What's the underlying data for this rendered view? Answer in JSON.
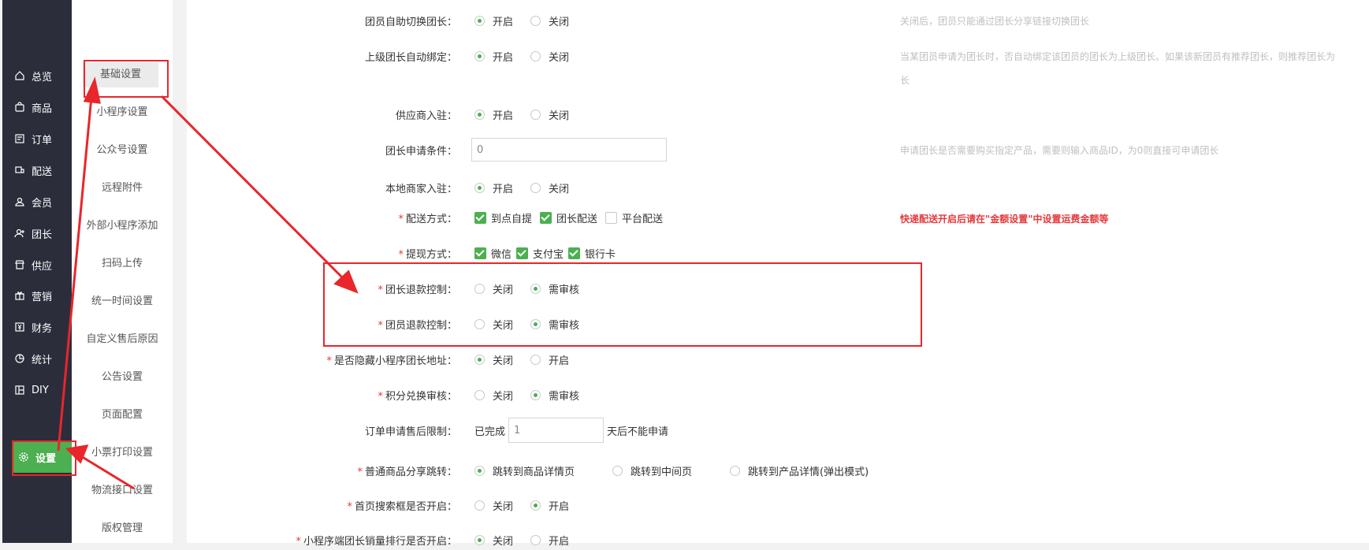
{
  "main_nav": [
    {
      "label": "总览",
      "icon": "home-icon"
    },
    {
      "label": "商品",
      "icon": "bag-icon"
    },
    {
      "label": "订单",
      "icon": "order-icon"
    },
    {
      "label": "配送",
      "icon": "delivery-icon"
    },
    {
      "label": "会员",
      "icon": "user-icon"
    },
    {
      "label": "团长",
      "icon": "leader-icon"
    },
    {
      "label": "供应",
      "icon": "store-icon"
    },
    {
      "label": "营销",
      "icon": "gift-icon"
    },
    {
      "label": "财务",
      "icon": "finance-icon"
    },
    {
      "label": "统计",
      "icon": "pie-chart-icon"
    },
    {
      "label": "DIY",
      "icon": "layout-icon"
    },
    {
      "label": "设置",
      "icon": "gear-icon",
      "active": true
    }
  ],
  "sub_nav": [
    {
      "label": "基础设置",
      "active": true
    },
    {
      "label": "小程序设置"
    },
    {
      "label": "公众号设置"
    },
    {
      "label": "远程附件"
    },
    {
      "label": "外部小程序添加"
    },
    {
      "label": "扫码上传"
    },
    {
      "label": "统一时间设置"
    },
    {
      "label": "自定义售后原因"
    },
    {
      "label": "公告设置"
    },
    {
      "label": "页面配置"
    },
    {
      "label": "小票打印设置"
    },
    {
      "label": "物流接口设置"
    },
    {
      "label": "版权管理"
    }
  ],
  "form": {
    "member_switch": {
      "label": "团员自助切换团长：",
      "opt1": "开启",
      "opt2": "关闭",
      "hint": "关闭后，团员只能通过团长分享链接切换团长"
    },
    "auto_bind": {
      "label": "上级团长自动绑定：",
      "opt1": "开启",
      "opt2": "关闭",
      "hint1": "当某团员申请为团长时，否自动绑定该团员的团长为上级团长。如果该新团员有推荐团长，则推荐团长为",
      "hint2": "长"
    },
    "supplier": {
      "label": "供应商入驻：",
      "opt1": "开启",
      "opt2": "关闭"
    },
    "apply_condition": {
      "label": "团长申请条件：",
      "value": "0",
      "hint": "申请团长是否需要购买指定产品，需要则输入商品ID，为0则直接可申请团长"
    },
    "local_merchant": {
      "label": "本地商家入驻：",
      "opt1": "开启",
      "opt2": "关闭"
    },
    "delivery": {
      "req": "*",
      "label": "配送方式：",
      "opt1": "到点自提",
      "opt2": "团长配送",
      "opt3": "平台配送",
      "hint": "快递配送开启后请在\"金额设置\"中设置运费金额等"
    },
    "withdraw": {
      "req": "*",
      "label": "提现方式：",
      "opt1": "微信",
      "opt2": "支付宝",
      "opt3": "银行卡"
    },
    "leader_refund": {
      "req": "*",
      "label": "团长退款控制：",
      "opt1": "关闭",
      "opt2": "需审核"
    },
    "member_refund": {
      "req": "*",
      "label": "团员退款控制：",
      "opt1": "关闭",
      "opt2": "需审核"
    },
    "hide_address": {
      "req": "*",
      "label": "是否隐藏小程序团长地址：",
      "opt1": "关闭",
      "opt2": "开启"
    },
    "points_review": {
      "req": "*",
      "label": "积分兑换审核：",
      "opt1": "关闭",
      "opt2": "需审核"
    },
    "after_sale": {
      "label": "订单申请售后限制：",
      "prefix": "已完成",
      "value": "1",
      "suffix": "天后不能申请"
    },
    "share_jump": {
      "req": "*",
      "label": "普通商品分享跳转：",
      "opt1": "跳转到商品详情页",
      "opt2": "跳转到中间页",
      "opt3": "跳转到产品详情(弹出模式)"
    },
    "search_box": {
      "req": "*",
      "label": "首页搜索框是否开启：",
      "opt1": "关闭",
      "opt2": "开启"
    },
    "sales_rank": {
      "req": "*",
      "label": "小程序端团长销量排行是否开启：",
      "opt1": "关闭",
      "opt2": "开启"
    }
  },
  "colors": {
    "accent": "#4caf50",
    "annotation": "#e8262b",
    "nav_bg": "#2b2d3b"
  }
}
